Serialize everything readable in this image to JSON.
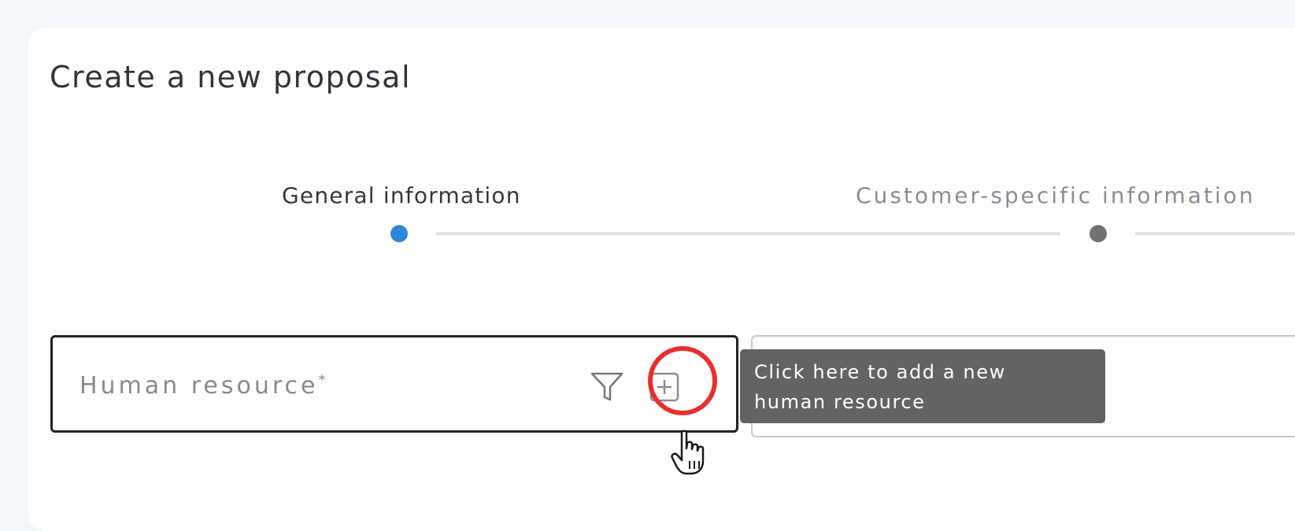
{
  "page": {
    "title": "Create a new proposal"
  },
  "stepper": {
    "steps": [
      {
        "label": "General information",
        "state": "active",
        "color": "#2e86d6"
      },
      {
        "label": "Customer-specific information",
        "state": "inactive",
        "color": "#737373"
      }
    ]
  },
  "form": {
    "human_resource": {
      "label": "Human resource",
      "required_marker": "*",
      "filter_icon": "filter-icon",
      "add_icon": "plus-square-icon"
    }
  },
  "tooltip": {
    "line1": "Click here to add a new",
    "line2": "human resource"
  },
  "annotation": {
    "highlight_color": "#ea2d2d",
    "cursor_icon": "hand-pointer-icon"
  }
}
